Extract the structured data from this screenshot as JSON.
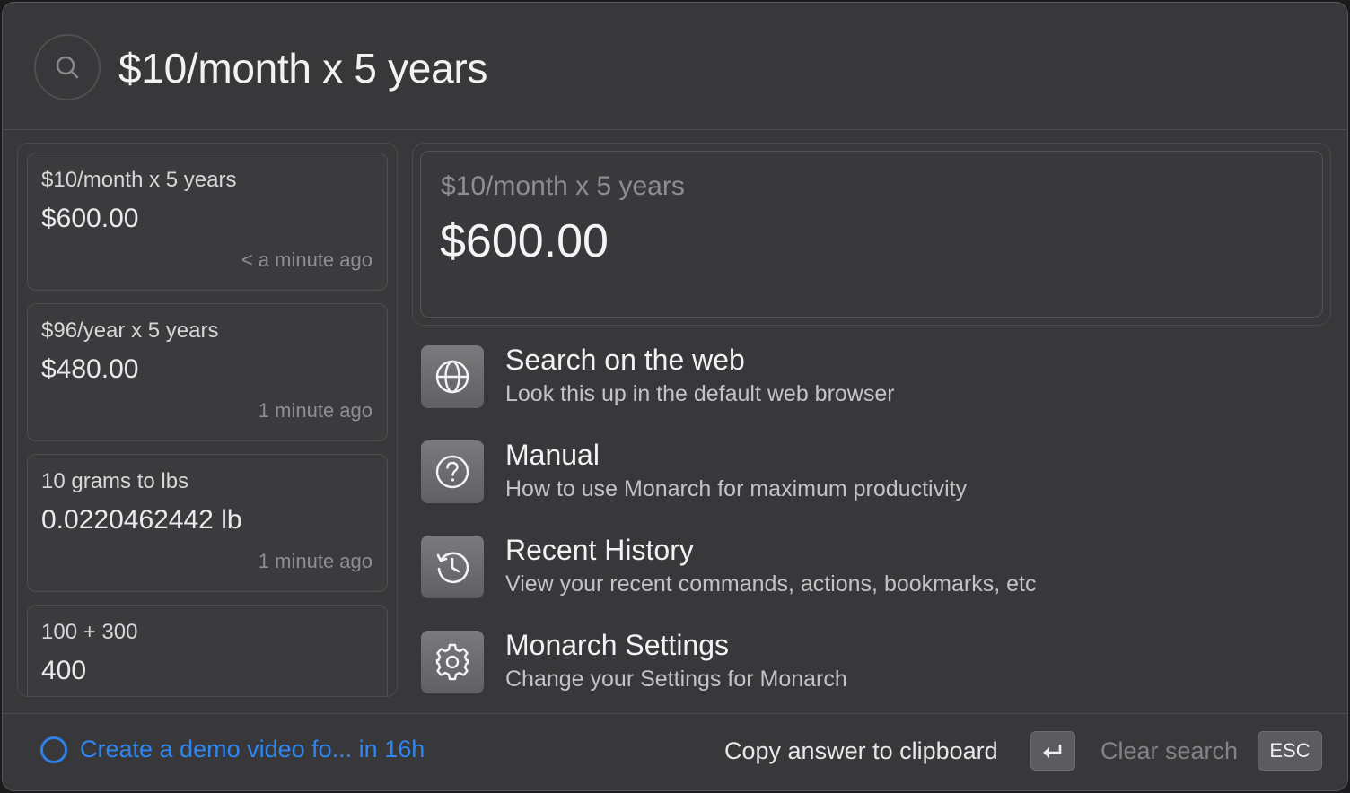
{
  "search": {
    "query": "$10/month x 5 years",
    "icon": "search-icon"
  },
  "history": [
    {
      "query": "$10/month x 5 years",
      "answer": "$600.00",
      "time": "< a minute ago"
    },
    {
      "query": "$96/year x 5 years",
      "answer": "$480.00",
      "time": "1 minute ago"
    },
    {
      "query": "10 grams to lbs",
      "answer": "0.0220462442 lb",
      "time": "1 minute ago"
    },
    {
      "query": "100 + 300",
      "answer": "400",
      "time": ""
    }
  ],
  "answer": {
    "query": "$10/month x 5 years",
    "value": "$600.00"
  },
  "actions": [
    {
      "title": "Search on the web",
      "desc": "Look this up in the default web browser",
      "icon": "globe-icon"
    },
    {
      "title": "Manual",
      "desc": "How to use Monarch for maximum productivity",
      "icon": "question-icon"
    },
    {
      "title": "Recent History",
      "desc": "View your recent commands, actions, bookmarks, etc",
      "icon": "history-icon"
    },
    {
      "title": "Monarch Settings",
      "desc": "Change your Settings for Monarch",
      "icon": "gear-icon"
    }
  ],
  "footer": {
    "reminder": "Create a demo video fo... in 16h",
    "copy_label": "Copy answer to clipboard",
    "clear_label": "Clear search",
    "esc_key": "ESC"
  },
  "colors": {
    "accent": "#2f86f0",
    "window": "#38383a"
  }
}
